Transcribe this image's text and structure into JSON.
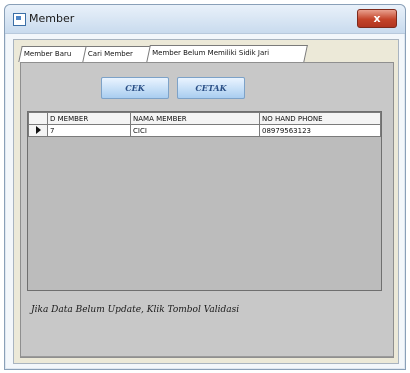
{
  "window": {
    "title": "Member",
    "close_glyph": "x",
    "app_icon": "form-icon"
  },
  "tabs": [
    {
      "label": "Member Baru"
    },
    {
      "label": "Cari Member"
    },
    {
      "label": "Member Belum Memiliki Sidik Jari"
    }
  ],
  "toolbar": {
    "cek_label": "CEK",
    "cetak_label": "CETAK"
  },
  "grid": {
    "columns": [
      "D MEMBER",
      "NAMA MEMBER",
      "NO HAND PHONE"
    ],
    "rows": [
      {
        "id": "7",
        "nama": "CICI",
        "phone": "08979563123"
      }
    ]
  },
  "note": "Jika Data Belum Update, Klik Tombol Validasi",
  "colors": {
    "close": "#c4442a",
    "button_text": "#2a4f86",
    "panel": "#c8c8c8"
  }
}
